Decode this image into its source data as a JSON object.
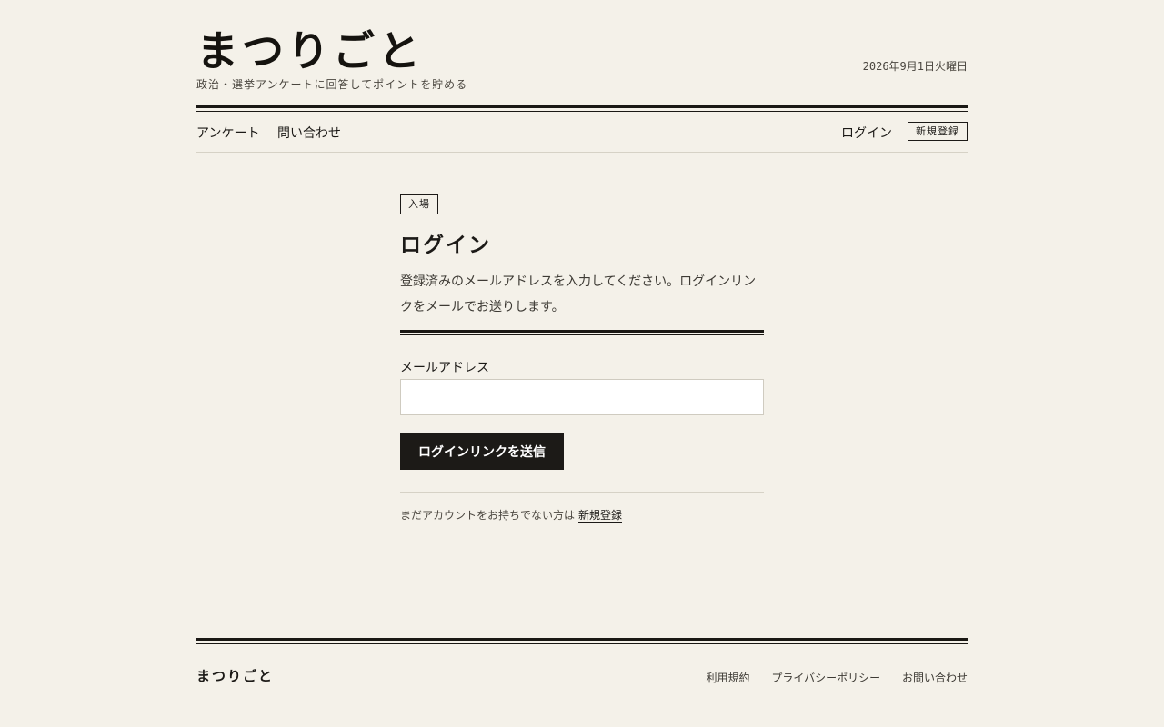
{
  "header": {
    "brand": "まつりごと",
    "tagline": "政治・選挙アンケートに回答してポイントを貯める",
    "date": "2026年9月1日火曜日"
  },
  "nav": {
    "survey": "アンケート",
    "contact": "問い合わせ",
    "login": "ログイン",
    "register": "新規登録"
  },
  "main": {
    "badge": "入場",
    "title": "ログイン",
    "description": "登録済みのメールアドレスを入力してください。ログインリンクをメールでお送りします。",
    "email_label": "メールアドレス",
    "email_value": "",
    "email_placeholder": "",
    "submit_label": "ログインリンクを送信",
    "signup_prompt": "まだアカウントをお持ちでない方は",
    "signup_link": "新規登録"
  },
  "footer": {
    "brand": "まつりごと",
    "links": [
      "利用規約",
      "プライバシーポリシー",
      "お問い合わせ"
    ]
  },
  "colors": {
    "background": "#f4f1e9",
    "ink": "#1c1a17",
    "button": "#1c1a17"
  }
}
